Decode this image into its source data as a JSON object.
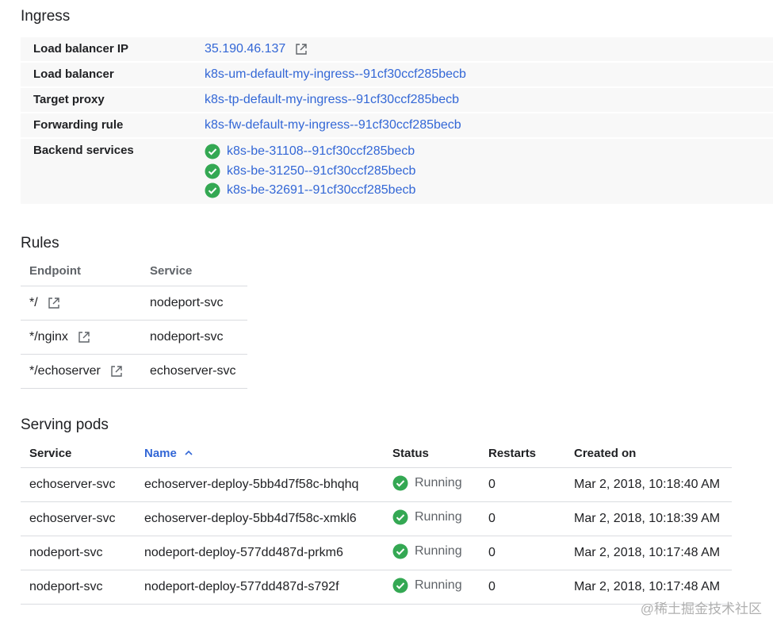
{
  "ingress": {
    "title": "Ingress",
    "rows": [
      {
        "label": "Load balancer IP",
        "value": "35.190.46.137"
      },
      {
        "label": "Load balancer",
        "value": "k8s-um-default-my-ingress--91cf30ccf285becb"
      },
      {
        "label": "Target proxy",
        "value": "k8s-tp-default-my-ingress--91cf30ccf285becb"
      },
      {
        "label": "Forwarding rule",
        "value": "k8s-fw-default-my-ingress--91cf30ccf285becb"
      }
    ],
    "backend_label": "Backend services",
    "backend_services": [
      "k8s-be-31108--91cf30ccf285becb",
      "k8s-be-31250--91cf30ccf285becb",
      "k8s-be-32691--91cf30ccf285becb"
    ]
  },
  "rules": {
    "title": "Rules",
    "headers": {
      "endpoint": "Endpoint",
      "service": "Service"
    },
    "rows": [
      {
        "endpoint": "*/",
        "service": "nodeport-svc"
      },
      {
        "endpoint": "*/nginx",
        "service": "nodeport-svc"
      },
      {
        "endpoint": "*/echoserver",
        "service": "echoserver-svc"
      }
    ]
  },
  "pods": {
    "title": "Serving pods",
    "headers": {
      "service": "Service",
      "name": "Name",
      "status": "Status",
      "restarts": "Restarts",
      "created": "Created on"
    },
    "rows": [
      {
        "service": "echoserver-svc",
        "name": "echoserver-deploy-5bb4d7f58c-bhqhq",
        "status": "Running",
        "restarts": "0",
        "created": "Mar 2, 2018, 10:18:40 AM"
      },
      {
        "service": "echoserver-svc",
        "name": "echoserver-deploy-5bb4d7f58c-xmkl6",
        "status": "Running",
        "restarts": "0",
        "created": "Mar 2, 2018, 10:18:39 AM"
      },
      {
        "service": "nodeport-svc",
        "name": "nodeport-deploy-577dd487d-prkm6",
        "status": "Running",
        "restarts": "0",
        "created": "Mar 2, 2018, 10:17:48 AM"
      },
      {
        "service": "nodeport-svc",
        "name": "nodeport-deploy-577dd487d-s792f",
        "status": "Running",
        "restarts": "0",
        "created": "Mar 2, 2018, 10:17:48 AM"
      }
    ]
  },
  "watermark": "@稀土掘金技术社区",
  "colors": {
    "link": "#3367d6",
    "success": "#34a853",
    "border": "#dadce0"
  }
}
